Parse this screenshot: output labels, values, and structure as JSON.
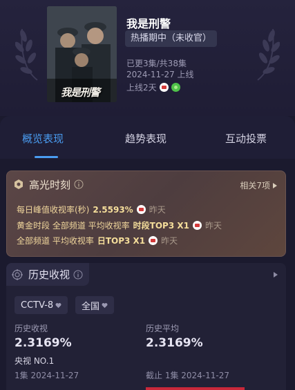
{
  "show": {
    "title": "我是刑警",
    "poster_title": "我是刑警",
    "status": "热播期中（未收官）",
    "episodes": "已更3集/共38集",
    "launch_date": "2024-11-27 上线",
    "days_online": "上线2天"
  },
  "tabs": [
    "概览表现",
    "趋势表现",
    "互动投票"
  ],
  "highlight": {
    "title": "高光时刻",
    "more": "相关7项",
    "rows": [
      {
        "label": "每日峰值收视率(秒)",
        "value": "2.5593%",
        "when": "昨天"
      },
      {
        "label": "黄金时段 全部频道 平均收视率",
        "value": "时段TOP3 X1",
        "when": "昨天"
      },
      {
        "label": "全部频道 平均收视率",
        "value": "日TOP3 X1",
        "when": "昨天"
      }
    ]
  },
  "history": {
    "title": "历史收视",
    "channel_filter": "CCTV-8",
    "region_filter": "全国",
    "col1": {
      "label": "历史收视",
      "value": "2.3169%",
      "sub": "央视 NO.1",
      "date": "1集 2024-11-27"
    },
    "col2": {
      "label": "历史平均",
      "value": "2.3169%",
      "date": "截止 1集 2024-11-27"
    }
  },
  "colors": {
    "accent": "#4a9df2",
    "highlight_text": "#f0d69c",
    "background": "#1b1a2e"
  }
}
